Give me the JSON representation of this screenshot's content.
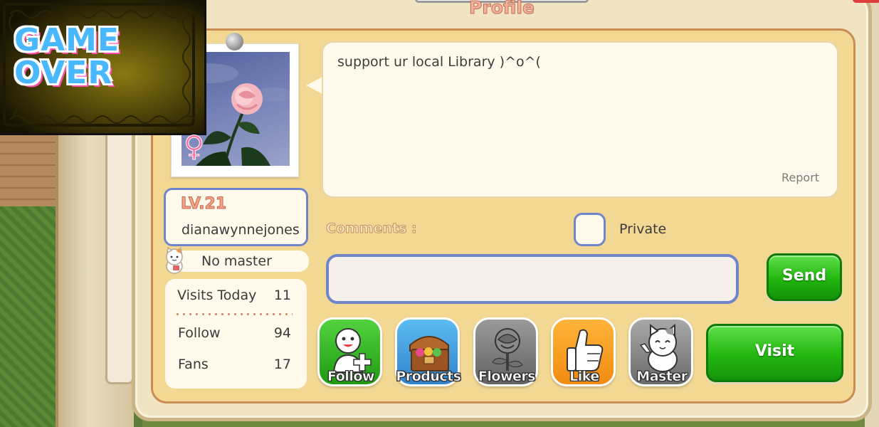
{
  "game_over": {
    "line1": "GAME",
    "line2": "OVER"
  },
  "profile": {
    "title": "Profile",
    "status_message": "support ur local Library )^o^(",
    "report_label": "Report",
    "level": "LV.21",
    "username": "dianawynnejones",
    "master_status": "No master",
    "stats": [
      {
        "label": "Visits Today",
        "value": "11"
      },
      {
        "label": "Follow",
        "value": "94"
      },
      {
        "label": "Fans",
        "value": "17"
      }
    ]
  },
  "comments": {
    "label": "Comments :",
    "private_label": "Private",
    "private_checked": false,
    "input_value": "",
    "send_label": "Send"
  },
  "actions": [
    {
      "label": "Follow",
      "icon": "follow-icon"
    },
    {
      "label": "Products",
      "icon": "products-icon"
    },
    {
      "label": "Flowers",
      "icon": "flowers-icon"
    },
    {
      "label": "Like",
      "icon": "like-icon"
    },
    {
      "label": "Master",
      "icon": "master-icon"
    }
  ],
  "visit_label": "Visit",
  "colors": {
    "panel_bg": "#f0e4c2",
    "inner_bg": "#f3d894",
    "accent_blue": "#7085c9",
    "button_green": "#22b60f"
  }
}
